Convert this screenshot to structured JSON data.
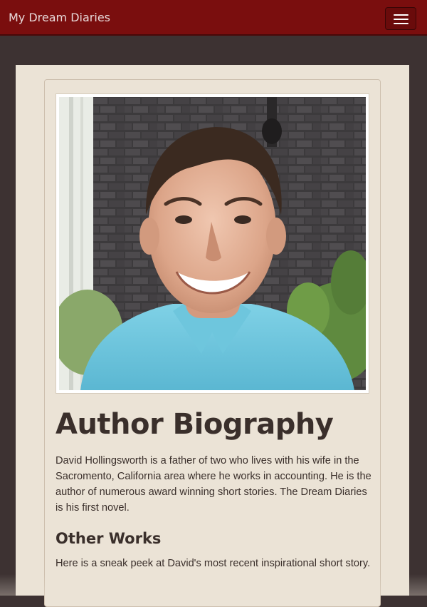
{
  "navbar": {
    "brand": "My Dream Diaries",
    "toggle_icon": "hamburger-menu-icon"
  },
  "colors": {
    "navbar": "#7a0e0e",
    "page_background": "#3d3232",
    "content_background": "#ebe3d6",
    "text": "#3a2f2b"
  },
  "author": {
    "photo_subject": "author-portrait",
    "heading": "Author Biography",
    "bio": "David Hollingsworth is a father of two who lives with his wife in the Sacromento, California area where he works in accounting. He is the author of numerous award winning short stories. The Dream Diaries is his first novel."
  },
  "other_works": {
    "heading": "Other Works",
    "teaser": "Here is a sneak peek at David's most recent inspirational short story."
  }
}
